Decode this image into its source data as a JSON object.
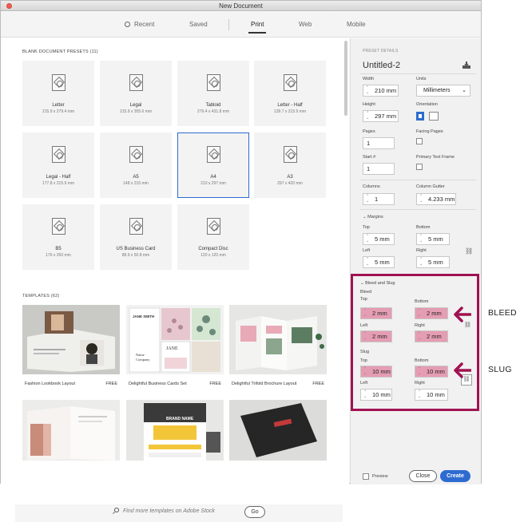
{
  "window": {
    "title": "New Document"
  },
  "tabs": [
    {
      "label": "Recent"
    },
    {
      "label": "Saved"
    },
    {
      "label": "Print"
    },
    {
      "label": "Web"
    },
    {
      "label": "Mobile"
    }
  ],
  "presets": {
    "heading": "BLANK DOCUMENT PRESETS",
    "count": "(11)",
    "items": [
      {
        "name": "Letter",
        "size": "215.9 x 279.4 mm"
      },
      {
        "name": "Legal",
        "size": "215.9 x 355.6 mm"
      },
      {
        "name": "Tabloid",
        "size": "279.4 x 431.8 mm"
      },
      {
        "name": "Letter - Half",
        "size": "139.7 x 215.9 mm"
      },
      {
        "name": "Legal - Half",
        "size": "177.8 x 215.9 mm"
      },
      {
        "name": "A5",
        "size": "148 x 210 mm"
      },
      {
        "name": "A4",
        "size": "210 x 297 mm"
      },
      {
        "name": "A3",
        "size": "297 x 420 mm"
      },
      {
        "name": "B5",
        "size": "176 x 250 mm"
      },
      {
        "name": "US Business Card",
        "size": "88.9 x 50.8 mm"
      },
      {
        "name": "Compact Disc",
        "size": "120 x 120 mm"
      }
    ]
  },
  "templates": {
    "heading": "TEMPLATES",
    "count": "(62)",
    "items": [
      {
        "name": "Fashion Lookbook Layout",
        "price": "FREE"
      },
      {
        "name": "Delightful Business Cards Set",
        "price": "FREE"
      },
      {
        "name": "Delightful Trifold Brochure Layout",
        "price": "FREE"
      }
    ],
    "card_business": {
      "person": "JANE SMITH",
      "company": "Name Company",
      "jane": "JANE"
    },
    "card_brand": {
      "name": "BRAND NAME"
    }
  },
  "search": {
    "placeholder": "Find more templates on Adobe Stock",
    "go": "Go"
  },
  "details": {
    "header": "PRESET DETAILS",
    "doc_name": "Untitled-2",
    "width_label": "Width",
    "width": "210 mm",
    "units_label": "Units",
    "units": "Millimeters",
    "height_label": "Height",
    "height": "297 mm",
    "orientation_label": "Orientation",
    "pages_label": "Pages",
    "pages": "1",
    "facing_label": "Facing Pages",
    "start_label": "Start #",
    "start": "1",
    "ptf_label": "Primary Text Frame",
    "columns_label": "Columns",
    "columns": "1",
    "gutter_label": "Column Gutter",
    "gutter": "4.233 mm",
    "margins": {
      "label": "Margins",
      "top_label": "Top",
      "top": "5 mm",
      "bottom_label": "Bottom",
      "bottom": "5 mm",
      "left_label": "Left",
      "left": "5 mm",
      "right_label": "Right",
      "right": "5 mm"
    },
    "bleed_slug_label": "Bleed and Slug",
    "bleed": {
      "label": "Bleed",
      "top_label": "Top",
      "top": "2 mm",
      "bottom_label": "Bottom",
      "bottom": "2 mm",
      "left_label": "Left",
      "left": "2 mm",
      "right_label": "Right",
      "right": "2 mm"
    },
    "slug": {
      "label": "Slug",
      "top_label": "Top",
      "top": "10 mm",
      "bottom_label": "Bottom",
      "bottom": "10 mm",
      "left_label": "Left",
      "left": "10 mm",
      "right_label": "Right",
      "right": "10 mm"
    }
  },
  "footer": {
    "preview": "Preview",
    "close": "Close",
    "create": "Create"
  },
  "annotations": {
    "bleed": "BLEED",
    "slug": "SLUG"
  },
  "colors": {
    "accent": "#2d6bd0",
    "highlight": "#e59db3",
    "annotation": "#a01253"
  }
}
